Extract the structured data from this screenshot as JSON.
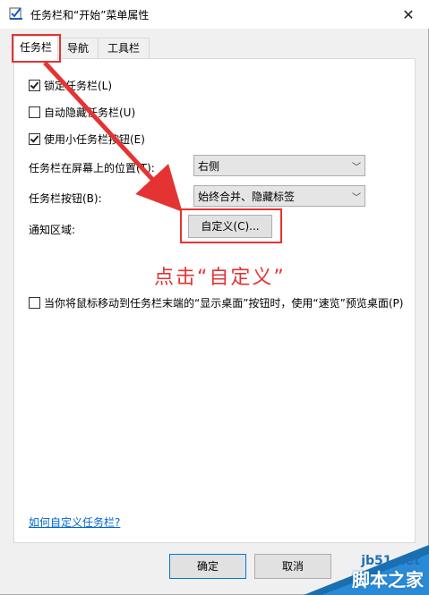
{
  "window": {
    "title": "任务栏和“开始”菜单属性",
    "close_glyph": "✕"
  },
  "tabs": [
    {
      "label": "任务栏",
      "active": true
    },
    {
      "label": "导航"
    },
    {
      "label": "工具栏"
    }
  ],
  "options": {
    "lock_taskbar": {
      "label": "锁定任务栏(L)",
      "checked": true
    },
    "auto_hide": {
      "label": "自动隐藏任务栏(U)",
      "checked": false
    },
    "small_buttons": {
      "label": "使用小任务栏按钮(E)",
      "checked": true
    },
    "peek": {
      "label": "当你将鼠标移动到任务栏末端的“显示桌面”按钮时，使用“速览”预览桌面(P)",
      "checked": false
    }
  },
  "location": {
    "label": "任务栏在屏幕上的位置(T):",
    "value": "右侧"
  },
  "buttons_setting": {
    "label": "任务栏按钮(B):",
    "value": "始终合并、隐藏标签"
  },
  "notification": {
    "label": "通知区域:",
    "button": "自定义(C)..."
  },
  "annotation": "点击“自定义”",
  "help_link": "如何自定义任务栏?",
  "footer": {
    "ok": "确定",
    "cancel": "取消"
  },
  "watermark": {
    "site": "jb51.net",
    "name": "脚本之家"
  },
  "colors": {
    "annotation_red": "#e53333",
    "link_blue": "#0066cc",
    "focus_blue": "#0078d7"
  }
}
